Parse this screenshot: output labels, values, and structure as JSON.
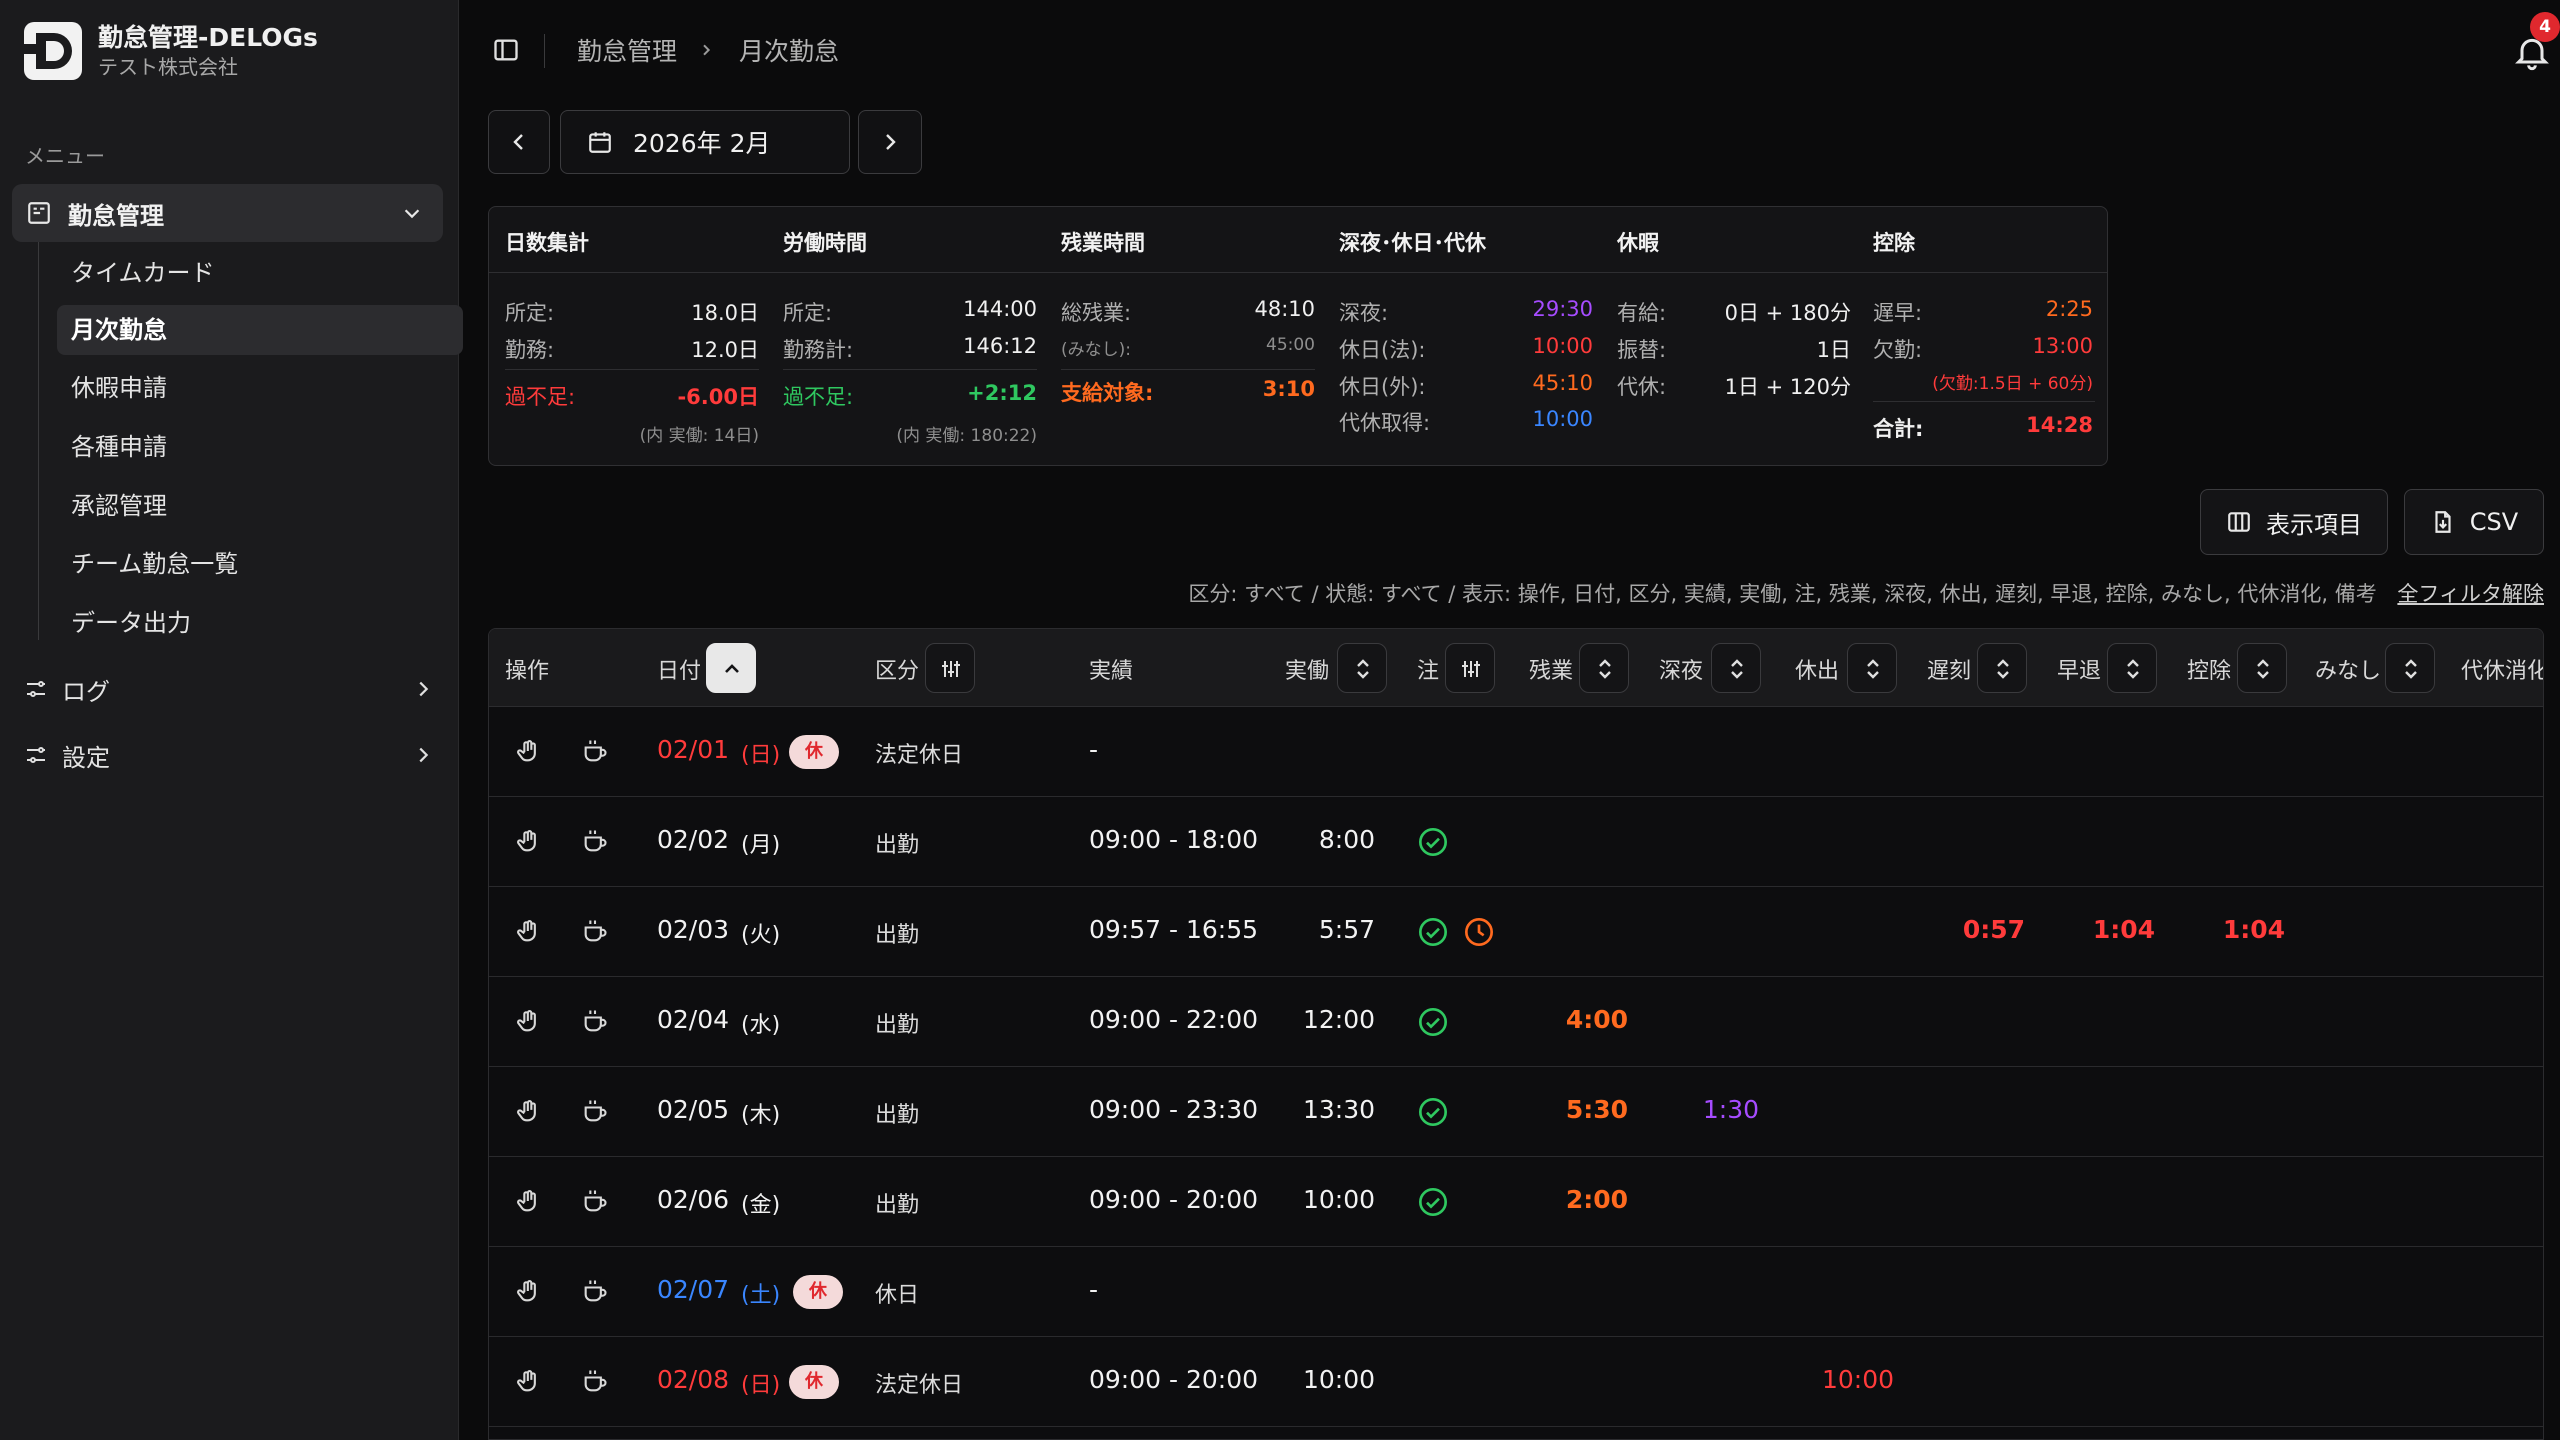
{
  "app": {
    "title": "勤怠管理-DELOGs",
    "company": "テスト株式会社"
  },
  "sidebar": {
    "menu_label": "メニュー",
    "group": {
      "label": "勤怠管理"
    },
    "items": [
      {
        "label": "タイムカード"
      },
      {
        "label": "月次勤怠"
      },
      {
        "label": "休暇申請"
      },
      {
        "label": "各種申請"
      },
      {
        "label": "承認管理"
      },
      {
        "label": "チーム勤怠一覧"
      },
      {
        "label": "データ出力"
      }
    ],
    "log": {
      "label": "ログ"
    },
    "settings": {
      "label": "設定"
    }
  },
  "header": {
    "breadcrumb": [
      "勤怠管理",
      "月次勤怠"
    ],
    "notification_count": "4"
  },
  "month_nav": {
    "label": "2026年 2月"
  },
  "summary": {
    "days": {
      "title": "日数集計",
      "scheduled_label": "所定:",
      "scheduled": "18.0日",
      "worked_label": "勤務:",
      "worked": "12.0日",
      "diff_label": "過不足:",
      "diff": "-6.00日",
      "note": "(内 実働: 14日)"
    },
    "hours": {
      "title": "労働時間",
      "scheduled_label": "所定:",
      "scheduled": "144:00",
      "total_label": "勤務計:",
      "total": "146:12",
      "diff_label": "過不足:",
      "diff": "+2:12",
      "note": "(内 実働: 180:22)"
    },
    "overtime": {
      "title": "残業時間",
      "total_label": "総残業:",
      "total": "48:10",
      "deemed_label": "(みなし):",
      "deemed": "45:00",
      "paid_label": "支給対象:",
      "paid": "3:10"
    },
    "night": {
      "title": "深夜･休日･代休",
      "night_label": "深夜:",
      "night": "29:30",
      "legal_holiday_label": "休日(法):",
      "legal_holiday": "10:00",
      "other_holiday_label": "休日(外):",
      "other_holiday": "45:10",
      "comp_label": "代休取得:",
      "comp": "10:00"
    },
    "leave": {
      "title": "休暇",
      "paid_label": "有給:",
      "paid": "0日 + 180分",
      "transfer_label": "振替:",
      "transfer": "1日",
      "comp_label": "代休:",
      "comp": "1日 + 120分"
    },
    "deduction": {
      "title": "控除",
      "late_label": "遅早:",
      "late": "2:25",
      "absence_label": "欠勤:",
      "absence": "13:00",
      "absence_note": "(欠勤:1.5日 + 60分)",
      "total_label": "合計:",
      "total": "14:28"
    }
  },
  "actions": {
    "columns_label": "表示項目",
    "csv_label": "CSV"
  },
  "filter": {
    "text": "区分: すべて / 状態: すべて / 表示: 操作, 日付, 区分, 実績, 実働, 注, 残業, 深夜, 休出, 遅刻, 早退, 控除, みなし, 代休消化, 備考",
    "clear_label": "全フィルタ解除"
  },
  "table": {
    "headers": {
      "ops": "操作",
      "date": "日付",
      "category": "区分",
      "actual": "実績",
      "worked": "実働",
      "note": "注",
      "overtime": "残業",
      "night": "深夜",
      "holiday_work": "休出",
      "late": "遅刻",
      "early": "早退",
      "deduction": "控除",
      "deemed": "みなし",
      "comp_used": "代休消化"
    },
    "holiday_badge": "休",
    "rows": [
      {
        "date": "02/01",
        "dow": "(日)",
        "category": "法定休日",
        "actual": "-",
        "worked": "",
        "overtime": "",
        "night": "",
        "holiday_work": "",
        "late": "",
        "early": "",
        "deduction": ""
      },
      {
        "date": "02/02",
        "dow": "(月)",
        "category": "出勤",
        "actual": "09:00 - 18:00",
        "worked": "8:00",
        "overtime": "",
        "night": "",
        "holiday_work": "",
        "late": "",
        "early": "",
        "deduction": ""
      },
      {
        "date": "02/03",
        "dow": "(火)",
        "category": "出勤",
        "actual": "09:57 - 16:55",
        "worked": "5:57",
        "overtime": "",
        "night": "",
        "holiday_work": "",
        "late": "0:57",
        "early": "1:04",
        "deduction": "1:04"
      },
      {
        "date": "02/04",
        "dow": "(水)",
        "category": "出勤",
        "actual": "09:00 - 22:00",
        "worked": "12:00",
        "overtime": "4:00",
        "night": "",
        "holiday_work": "",
        "late": "",
        "early": "",
        "deduction": ""
      },
      {
        "date": "02/05",
        "dow": "(木)",
        "category": "出勤",
        "actual": "09:00 - 23:30",
        "worked": "13:30",
        "overtime": "5:30",
        "night": "1:30",
        "holiday_work": "",
        "late": "",
        "early": "",
        "deduction": ""
      },
      {
        "date": "02/06",
        "dow": "(金)",
        "category": "出勤",
        "actual": "09:00 - 20:00",
        "worked": "10:00",
        "overtime": "2:00",
        "night": "",
        "holiday_work": "",
        "late": "",
        "early": "",
        "deduction": ""
      },
      {
        "date": "02/07",
        "dow": "(土)",
        "category": "休日",
        "actual": "-",
        "worked": "",
        "overtime": "",
        "night": "",
        "holiday_work": "",
        "late": "",
        "early": "",
        "deduction": ""
      },
      {
        "date": "02/08",
        "dow": "(日)",
        "category": "法定休日",
        "actual": "09:00 - 20:00",
        "worked": "10:00",
        "overtime": "",
        "night": "",
        "holiday_work": "10:00",
        "late": "",
        "early": "",
        "deduction": ""
      }
    ]
  },
  "colors": {
    "red": "#ff3b3b",
    "orange": "#ff6a1f",
    "green": "#2fc860",
    "purple": "#a64cff",
    "blue": "#3a86ff",
    "badge_bg": "#f4dada"
  }
}
